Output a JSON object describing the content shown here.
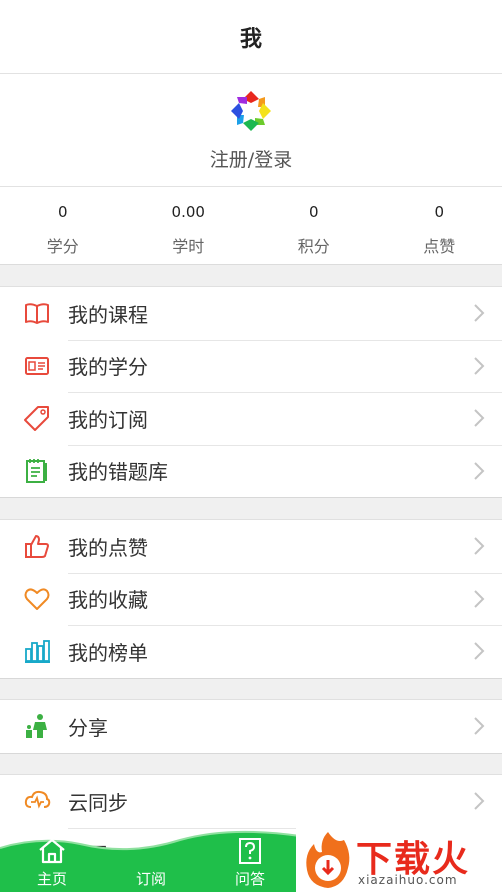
{
  "header": {
    "title": "我"
  },
  "profile": {
    "login_label": "注册/登录"
  },
  "stats": [
    {
      "value": "0",
      "label": "学分"
    },
    {
      "value": "0.00",
      "label": "学时"
    },
    {
      "value": "0",
      "label": "积分"
    },
    {
      "value": "0",
      "label": "点赞"
    }
  ],
  "group1": [
    {
      "label": "我的课程",
      "icon": "book-icon"
    },
    {
      "label": "我的学分",
      "icon": "id-card-icon"
    },
    {
      "label": "我的订阅",
      "icon": "tag-icon"
    },
    {
      "label": "我的错题库",
      "icon": "notebook-icon"
    }
  ],
  "group2": [
    {
      "label": "我的点赞",
      "icon": "thumbs-up-icon"
    },
    {
      "label": "我的收藏",
      "icon": "heart-icon"
    },
    {
      "label": "我的榜单",
      "icon": "bar-chart-icon"
    }
  ],
  "group3": [
    {
      "label": "分享",
      "icon": "share-people-icon"
    }
  ],
  "group4": [
    {
      "label": "云同步",
      "icon": "cloud-sync-icon"
    },
    {
      "label": "设置",
      "icon": "settings-icon"
    }
  ],
  "tabbar": [
    {
      "label": "主页",
      "icon": "home-icon"
    },
    {
      "label": "订阅",
      "icon": "subscribe-icon"
    },
    {
      "label": "问答",
      "icon": "question-icon"
    }
  ],
  "watermark": {
    "title": "下载火",
    "url": "xiazaihuo.com"
  },
  "colors": {
    "red": "#e84a3c",
    "green": "#3cb043",
    "orange": "#f08a24",
    "cyan": "#18a9c9",
    "tab_green": "#1fbf4a"
  }
}
